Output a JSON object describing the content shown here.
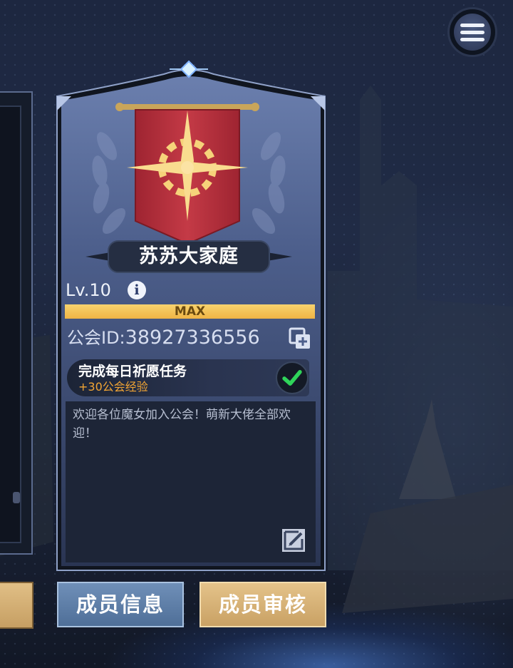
{
  "guild": {
    "name": "苏苏大家庭",
    "level_text": "Lv.10",
    "xp_label": "MAX",
    "xp_progress": 1.0,
    "id_label": "公会ID:",
    "id_value": "38927336556",
    "notice": "欢迎各位魔女加入公会！萌新大佬全部欢迎！"
  },
  "task": {
    "title": "完成每日祈愿任务",
    "reward": "+30公会经验",
    "completed": true
  },
  "buttons": {
    "member_info": "成员信息",
    "member_review": "成员审核"
  },
  "icons": {
    "menu": "hamburger-menu-icon",
    "info": "info-icon",
    "copy": "copy-icon",
    "check": "checkmark-icon",
    "edit": "edit-icon",
    "emblem": "guild-banner-emblem"
  },
  "colors": {
    "xp_bar": "#f0b445",
    "reward_text": "#f2a534",
    "check": "#2fd45a",
    "banner": "#c43a46"
  }
}
